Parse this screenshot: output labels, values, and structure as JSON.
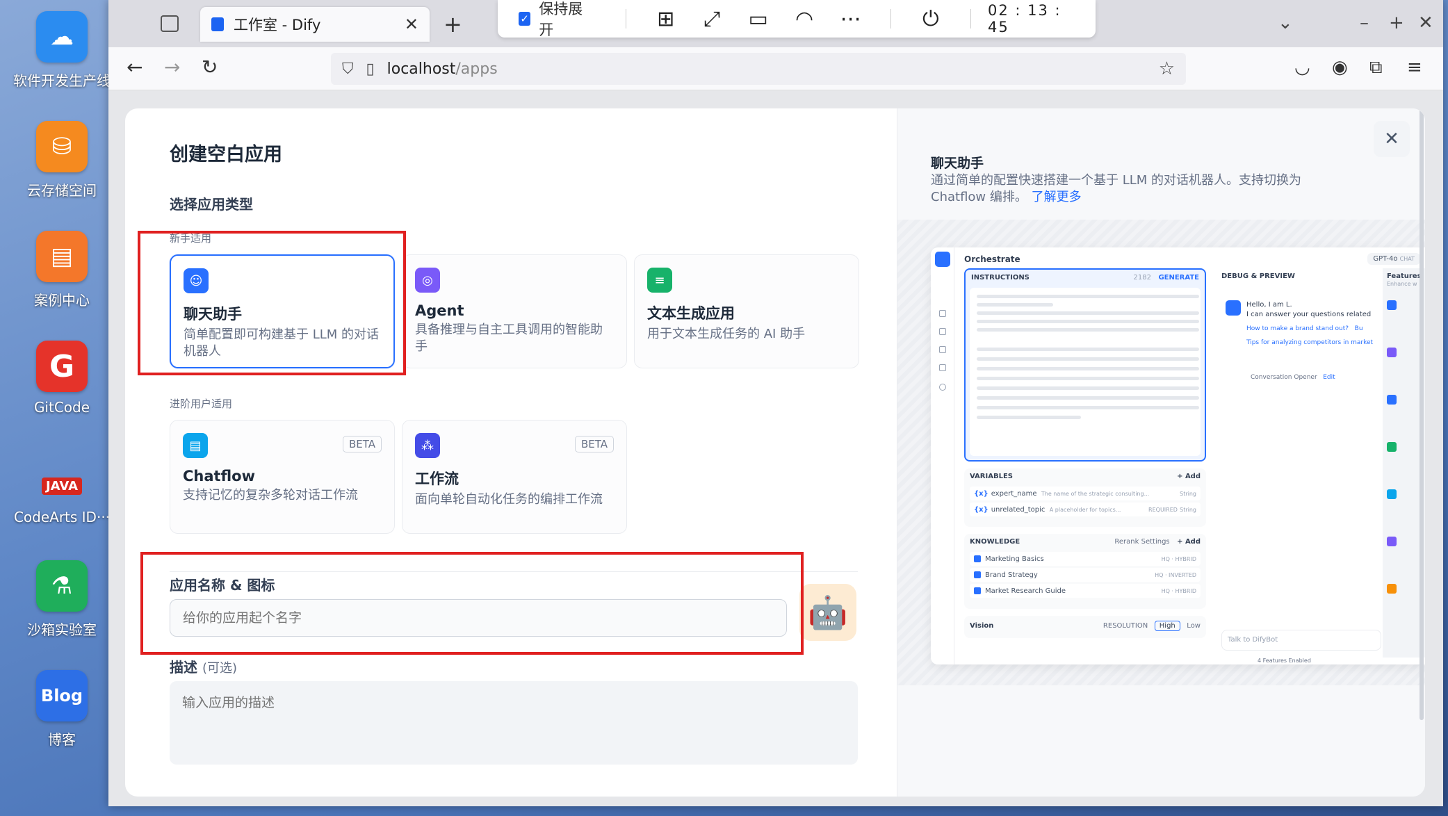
{
  "desktop": {
    "icons": [
      {
        "label": "软件开发生产线",
        "color": "#2b8cf0",
        "glyph": "cloud-icon"
      },
      {
        "label": "云存储空间",
        "color": "#f58a1f",
        "glyph": "storage-icon"
      },
      {
        "label": "案例中心",
        "color": "#f4772a",
        "glyph": "case-icon"
      },
      {
        "label": "GitCode",
        "color": "#e5332a",
        "glyph": "G"
      },
      {
        "label": "CodeArts ID···",
        "color": "#e8eaef",
        "glyph": "JAVA"
      },
      {
        "label": "沙箱实验室",
        "color": "#1fae5b",
        "glyph": "flask-icon"
      },
      {
        "label": "博客",
        "color": "#2d6fe6",
        "glyph": "Blog"
      }
    ]
  },
  "browser": {
    "tab_title": "工作室 - Dify",
    "url_host": "localhost",
    "url_path": "/apps"
  },
  "remote_toolbar": {
    "keep_expanded_label": "保持展开",
    "keep_expanded_checked": true,
    "timer": "02 : 13 : 45"
  },
  "modal": {
    "title": "创建空白应用",
    "section_title": "选择应用类型",
    "beginner_label": "新手适用",
    "advanced_label": "进阶用户适用",
    "beta_label": "BETA",
    "app_types": [
      {
        "name": "聊天助手",
        "desc": "简单配置即可构建基于 LLM 的对话机器人",
        "color": "#2970ff",
        "selected": true
      },
      {
        "name": "Agent",
        "desc": "具备推理与自主工具调用的智能助手",
        "color": "#7a5af8",
        "selected": false
      },
      {
        "name": "文本生成应用",
        "desc": "用于文本生成任务的 AI 助手",
        "color": "#17b26a",
        "selected": false
      },
      {
        "name": "Chatflow",
        "desc": "支持记忆的复杂多轮对话工作流",
        "color": "#0ba5ec",
        "selected": false,
        "beta": true
      },
      {
        "name": "工作流",
        "desc": "面向单轮自动化任务的编排工作流",
        "color": "#444ce7",
        "selected": false,
        "beta": true
      }
    ],
    "name_label": "应用名称 & 图标",
    "name_placeholder": "给你的应用起个名字",
    "desc_label": "描述",
    "desc_optional": "(可选)",
    "desc_placeholder": "输入应用的描述"
  },
  "preview_panel": {
    "title": "聊天助手",
    "desc": "通过简单的配置快速搭建一个基于 LLM 的对话机器人。支持切换为 Chatflow 编排。",
    "learn_more": "了解更多",
    "shot": {
      "header": "Orchestrate",
      "model": "GPT-4o",
      "model_tag": "CHAT",
      "instructions": "INSTRUCTIONS",
      "instr_count": "2182",
      "generate": "GENERATE",
      "variables": "VARIABLES",
      "add": "+ Add",
      "variable_rows": [
        {
          "name": "expert_name",
          "desc": "The name of the strategic consulting...",
          "type": "String"
        },
        {
          "name": "unrelated_topic",
          "desc": "A placeholder for topics...",
          "type": "String"
        }
      ],
      "required_tag": "REQUIRED",
      "knowledge": "KNOWLEDGE",
      "rerank": "Rerank Settings",
      "knowledge_rows": [
        {
          "name": "Marketing Basics",
          "tag": "HQ · HYBRID"
        },
        {
          "name": "Brand Strategy",
          "tag": "HQ · INVERTED"
        },
        {
          "name": "Market Research Guide",
          "tag": "HQ · HYBRID"
        }
      ],
      "vision": "Vision",
      "resolution": "RESOLUTION",
      "high": "High",
      "low": "Low",
      "debug": "DEBUG & PREVIEW",
      "hello": "Hello, I am L.",
      "hello2": "I can answer your questions related",
      "sug1": "How to make a brand stand out?",
      "sug1_extra": "Bu",
      "sug2": "Tips for analyzing competitors in market",
      "opener": "Conversation Opener",
      "edit": "Edit",
      "talk": "Talk to DifyBot",
      "features_enabled": "4 Features Enabled",
      "features": "Features",
      "features_sub": "Enhance w"
    }
  }
}
